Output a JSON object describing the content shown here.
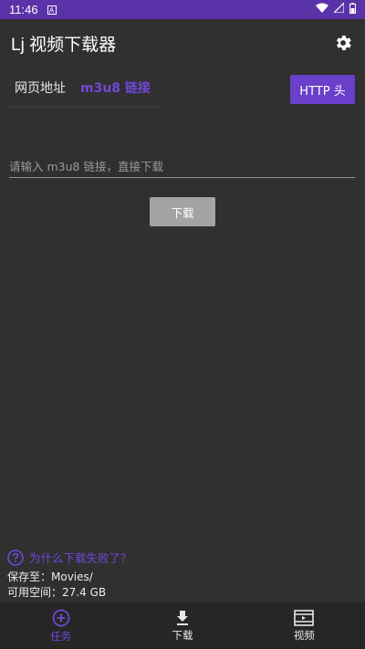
{
  "status_bar": {
    "time": "11:46",
    "badge": "A"
  },
  "app_bar": {
    "title": "Lj 视频下载器"
  },
  "tabs": [
    {
      "label": "网页地址",
      "active": false
    },
    {
      "label": "m3u8 链接",
      "active": true
    }
  ],
  "http_button": {
    "label": "HTTP 头"
  },
  "url_input": {
    "placeholder": "请输入 m3u8 链接，直接下载",
    "value": ""
  },
  "download_button": {
    "label": "下载"
  },
  "help": {
    "text": "为什么下载失败了？"
  },
  "storage": {
    "save_to": "保存至：Movies/",
    "free_space": "可用空间：27.4 GB"
  },
  "bottom_nav": [
    {
      "label": "任务",
      "icon": "add-circle-icon",
      "active": true
    },
    {
      "label": "下载",
      "icon": "download-icon",
      "active": false
    },
    {
      "label": "视频",
      "icon": "video-icon",
      "active": false
    }
  ],
  "colors": {
    "accent": "#6a3fc9",
    "status_bar": "#5a33a8",
    "background": "#303030"
  }
}
